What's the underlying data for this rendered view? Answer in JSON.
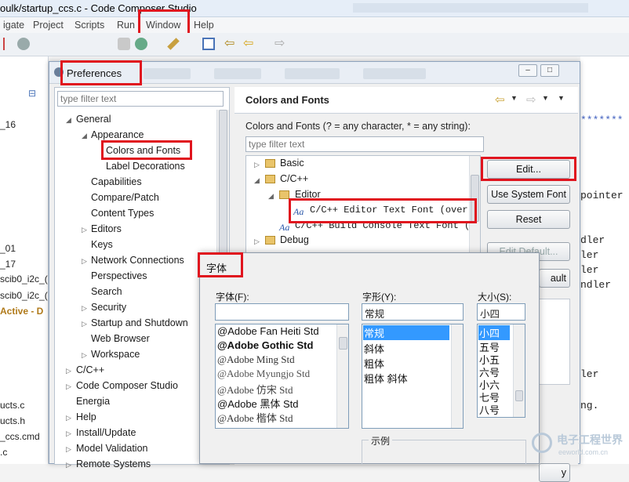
{
  "window": {
    "title": "oulk/startup_ccs.c - Code Composer Studio"
  },
  "menubar": [
    "igate",
    "Project",
    "Scripts",
    "Run",
    "Window",
    "Help"
  ],
  "background_left": [
    "_16",
    "_01",
    "_17",
    "scib0_i2c_(",
    "scib0_i2c_(",
    "Active - D",
    "ucts.c",
    "ucts.h",
    "_ccs.cmd",
    ".c"
  ],
  "background_right": [
    "*******",
    "pointer",
    "dler",
    "ler",
    "ler",
    "ndler",
    "ler",
    "ng."
  ],
  "preferences": {
    "title": "Preferences",
    "filter_placeholder": "type filter text",
    "tree": [
      "General",
      "Appearance",
      "Colors and Fonts",
      "Label Decorations",
      "Capabilities",
      "Compare/Patch",
      "Content Types",
      "Editors",
      "Keys",
      "Network Connections",
      "Perspectives",
      "Search",
      "Security",
      "Startup and Shutdown",
      "Web Browser",
      "Workspace",
      "C/C++",
      "Code Composer Studio",
      "Energia",
      "Help",
      "Install/Update",
      "Model Validation",
      "Remote Systems"
    ],
    "page_title": "Colors and Fonts",
    "description": "Colors and Fonts (? = any character, * = any string):",
    "cf_filter_placeholder": "type filter text",
    "cf_tree": [
      "Basic",
      "C/C++",
      "Editor",
      "C/C++ Editor Text Font (overr",
      "C/C++ Build Console Text Font (s",
      "Debug"
    ],
    "buttons": {
      "edit": "Edit...",
      "system_font": "Use System Font",
      "reset": "Reset",
      "edit_default": "Edit Default...",
      "partial": "ault",
      "partial2": "y"
    }
  },
  "font_dialog": {
    "title": "字体",
    "font_label": "字体(F):",
    "style_label": "字形(Y):",
    "size_label": "大小(S):",
    "font_value": "",
    "style_value": "常规",
    "size_value": "小四",
    "fonts": [
      "@Adobe Fan Heiti Std",
      "@Adobe Gothic Std",
      "@Adobe Ming Std",
      "@Adobe Myungjo Std",
      "@Adobe 仿宋 Std",
      "@Adobe 黑体 Std",
      "@Adobe 楷体 Std"
    ],
    "styles": [
      "常规",
      "斜体",
      "粗体",
      "粗体 斜体"
    ],
    "sizes": [
      "小四",
      "五号",
      "小五",
      "六号",
      "小六",
      "七号",
      "八号"
    ],
    "sample_label": "示例"
  },
  "watermark": {
    "line1": "电子工程世界",
    "line2": "eeworld.com.cn"
  }
}
